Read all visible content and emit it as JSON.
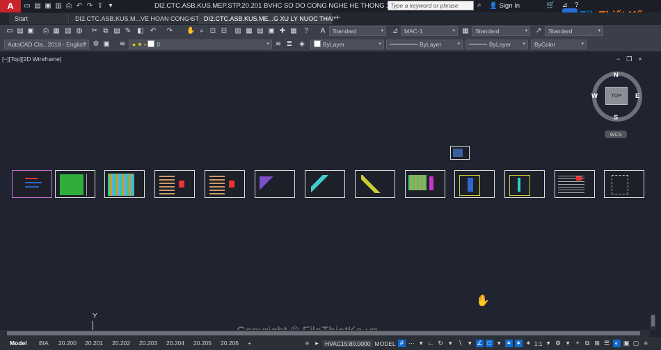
{
  "titlebar": {
    "title": "DI2.CTC.ASB.KUS.MEP.STP.20.201 BVHC SO DO CONG NGHE HE THONG XU LY NUO...",
    "search_placeholder": "Type a keyword or phrase",
    "signin": "Sign In"
  },
  "logo": {
    "prefix": "File",
    "brand": "Thiết Kế",
    "suffix": ".vn"
  },
  "tabs": [
    {
      "label": "Start"
    },
    {
      "label": "DI2.CTC.ASB.KUS.M...VE HOAN CONG STP*"
    },
    {
      "label": "DI2.CTC.ASB.KUS.ME...G XU LY NUOC THAI*"
    }
  ],
  "toolbar": {
    "text_style": "Standard",
    "dim_style": "MAC-1",
    "table_style": "Standard",
    "mleader_style": "Standard",
    "workspace": "AutoCAD Cla...2018 - English",
    "layer": "0",
    "color": "ByLayer",
    "linetype": "ByLayer",
    "lineweight": "ByLayer",
    "plotstyle": "ByColor"
  },
  "viewport": {
    "label": "[−][Top][2D Wireframe]",
    "viewcube": {
      "top": "TOP",
      "n": "N",
      "s": "S",
      "e": "E",
      "w": "W"
    },
    "wcs": "WCS",
    "ucs_y": "Y"
  },
  "watermark": "Copyright © FileThietKe.vn",
  "layout_tabs": [
    "Model",
    "BIA",
    "20.200",
    "20.201",
    "20.202",
    "20.203",
    "20.204",
    "20.205",
    "20.206"
  ],
  "status": {
    "coord": "HVAC15:80.0000",
    "model": "MODEL",
    "scale": "1:1"
  },
  "colors": {
    "accent": "#0f6ad0",
    "logo_red": "#c8242b",
    "canvas": "#1f2430"
  }
}
